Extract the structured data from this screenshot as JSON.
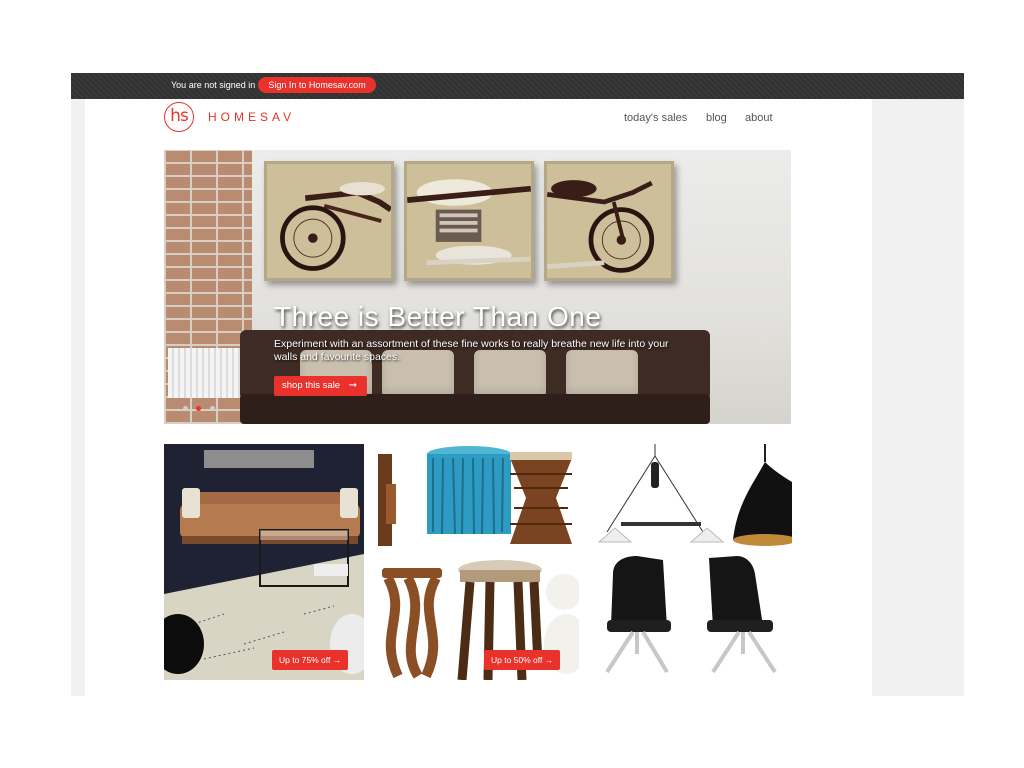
{
  "topbar": {
    "signed_out_text": "You are not signed in",
    "signin_label": "Sign In to Homesav.com"
  },
  "logo": {
    "mark": "hs",
    "name": "HOMESAV"
  },
  "nav": {
    "items": [
      "today's sales",
      "blog",
      "about"
    ]
  },
  "hero": {
    "title": "Three is Better Than One",
    "description": "Experiment with an assortment of these fine works to really breathe new life into your walls and favourite spaces.",
    "cta_label": "shop this sale",
    "cta_icon": "arrow-right-icon",
    "carousel_slide_count": 3,
    "carousel_active_index": 1
  },
  "tiles": [
    {
      "subject": "leather sofa living room",
      "badge": "Up to 75% off →"
    },
    {
      "subject": "wood and teal stools",
      "badge": "Up to 50% off →"
    },
    {
      "subject": "pendant lamps and black chairs",
      "badge": ""
    }
  ],
  "colors": {
    "accent": "#e8322b",
    "topbar": "#333333",
    "frame_bg": "#f1f1f1",
    "nav_text": "#555555"
  }
}
